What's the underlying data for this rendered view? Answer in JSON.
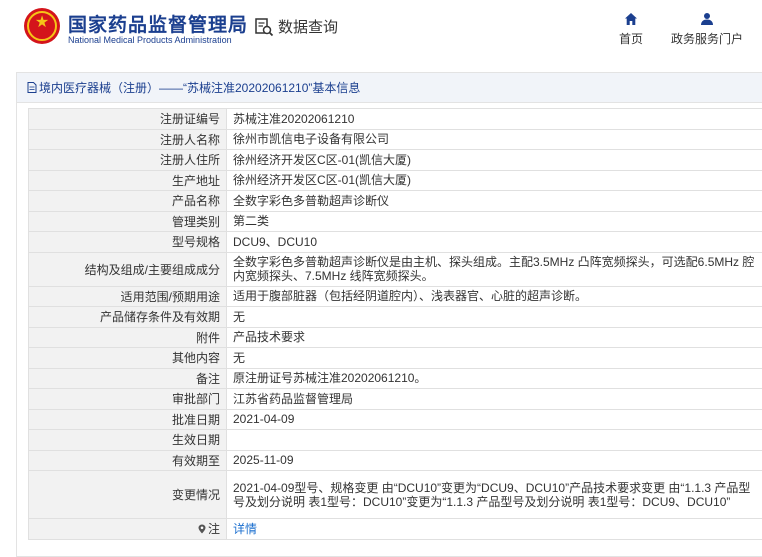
{
  "header": {
    "logo_cn": "国家药品监督管理局",
    "logo_en": "National Medical Products Administration",
    "data_query": "数据查询",
    "nav": {
      "home": "首页",
      "gov_portal": "政务服务门户"
    }
  },
  "section": {
    "title": "境内医疗器械（注册）——“苏械注准20202061210”基本信息"
  },
  "rows": [
    {
      "label": "注册证编号",
      "value": "苏械注准20202061210"
    },
    {
      "label": "注册人名称",
      "value": "徐州市凯信电子设备有限公司"
    },
    {
      "label": "注册人住所",
      "value": "徐州经济开发区C区-01(凯信大厦)"
    },
    {
      "label": "生产地址",
      "value": "徐州经济开发区C区-01(凯信大厦)"
    },
    {
      "label": "产品名称",
      "value": "全数字彩色多普勒超声诊断仪"
    },
    {
      "label": "管理类别",
      "value": "第二类"
    },
    {
      "label": "型号规格",
      "value": "DCU9、DCU10"
    },
    {
      "label": "结构及组成/主要组成成分",
      "value": "全数字彩色多普勒超声诊断仪是由主机、探头组成。主配3.5MHz 凸阵宽频探头，可选配6.5MHz 腔内宽频探头、7.5MHz 线阵宽频探头。"
    },
    {
      "label": "适用范围/预期用途",
      "value": "适用于腹部脏器（包括经阴道腔内）、浅表器官、心脏的超声诊断。"
    },
    {
      "label": "产品储存条件及有效期",
      "value": "无"
    },
    {
      "label": "附件",
      "value": "产品技术要求"
    },
    {
      "label": "其他内容",
      "value": "无"
    },
    {
      "label": "备注",
      "value": "原注册证号苏械注准20202061210。"
    },
    {
      "label": "审批部门",
      "value": "江苏省药品监督管理局"
    },
    {
      "label": "批准日期",
      "value": "2021-04-09"
    },
    {
      "label": "生效日期",
      "value": ""
    },
    {
      "label": "有效期至",
      "value": "2025-11-09"
    },
    {
      "label": "变更情况",
      "value": "2021-04-09型号、规格变更 由“DCU10”变更为“DCU9、DCU10”产品技术要求变更 由“1.1.3 产品型号及划分说明 表1型号：DCU10”变更为“1.1.3 产品型号及划分说明 表1型号：DCU9、DCU10”"
    },
    {
      "label": "注",
      "value": "详情"
    }
  ],
  "colors": {
    "brand_blue": "#1b3f8f",
    "emblem_red": "#d4141b",
    "link_blue": "#1b6fcf",
    "label_bg": "#f2f2f2"
  },
  "icons": {
    "logo": "national-emblem-icon",
    "data_query": "search-doc-icon",
    "home": "home-icon",
    "gov": "user-icon",
    "section": "document-icon",
    "note": "pin-icon"
  }
}
